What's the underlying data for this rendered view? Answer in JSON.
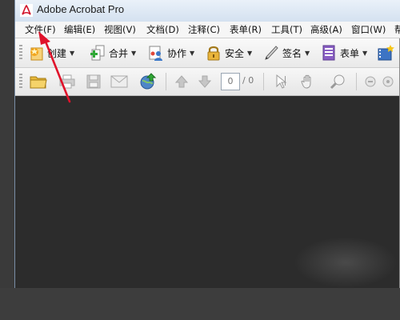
{
  "window": {
    "title": "Adobe Acrobat Pro"
  },
  "menu": [
    {
      "label": "文件(F)"
    },
    {
      "label": "编辑(E)"
    },
    {
      "label": "视图(V)"
    },
    {
      "label": "文档(D)"
    },
    {
      "label": "注释(C)"
    },
    {
      "label": "表单(R)"
    },
    {
      "label": "工具(T)"
    },
    {
      "label": "高级(A)"
    },
    {
      "label": "窗口(W)"
    },
    {
      "label": "帮"
    }
  ],
  "toolbar": {
    "create": "创建",
    "combine": "合并",
    "collaborate": "协作",
    "secure": "安全",
    "sign": "签名",
    "forms": "表单"
  },
  "nav": {
    "page_current": "0",
    "page_total": "/ 0"
  },
  "colors": {
    "annotation_arrow": "#e0132b",
    "doc_background": "#2c2c2c"
  }
}
